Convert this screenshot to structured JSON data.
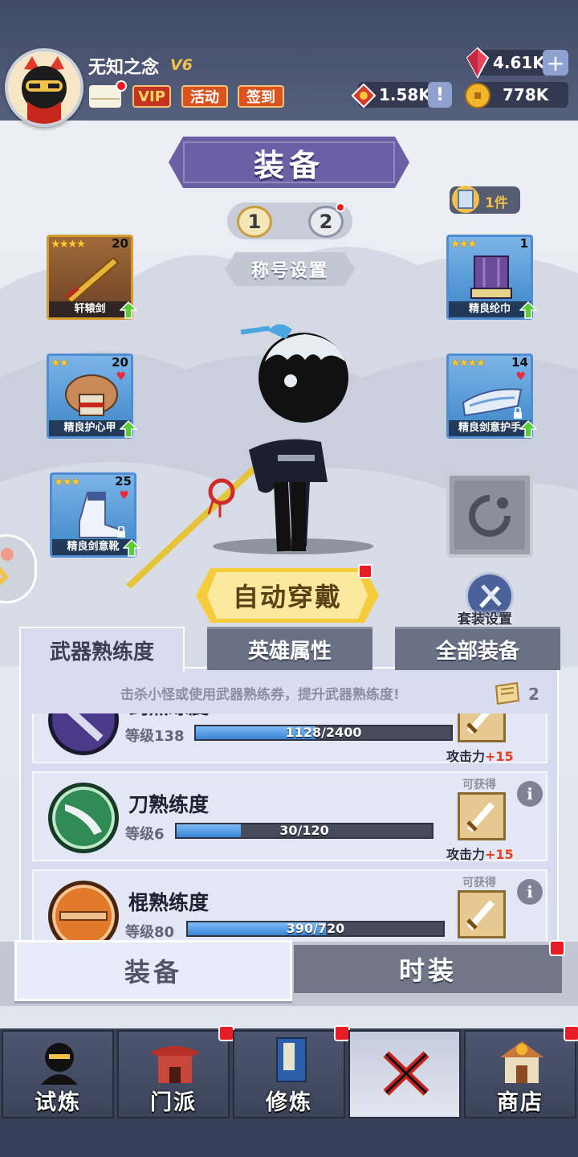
{
  "header": {
    "player_name": "无知之念",
    "vip_level": "V6",
    "buttons": {
      "vip": "VIP",
      "event": "活动",
      "signin": "签到"
    },
    "resources": {
      "gems": "4.61K",
      "tokens": "1.58K",
      "coins": "778K"
    }
  },
  "equipment": {
    "title": "装备",
    "pages": [
      "1",
      "2"
    ],
    "title_setting": "称号设置",
    "scroll_count": "1件",
    "slots": {
      "weapon": {
        "name": "轩辕剑",
        "level": "20",
        "stars": "★★★★"
      },
      "armor": {
        "name": "精良护心甲",
        "level": "20",
        "stars": "★★"
      },
      "boots": {
        "name": "精良剑意靴",
        "level": "25",
        "stars": "★★★"
      },
      "hat": {
        "name": "精良纶巾",
        "level": "1",
        "stars": "★★★"
      },
      "wrist": {
        "name": "精良剑意护手",
        "level": "14",
        "stars": "★★★★"
      }
    },
    "auto_equip": "自动穿戴",
    "set_setting": "套装设置"
  },
  "tabs": [
    "武器熟练度",
    "英雄属性",
    "全部装备"
  ],
  "mastery": {
    "hint": "击杀小怪或使用武器熟练券，提升武器熟练度!",
    "hint_count": "2",
    "items": [
      {
        "name": "剑熟练度",
        "level": "等级138",
        "progress": "1128/2400",
        "progress_fraction": 0.47,
        "obtain": "",
        "atk_label": "攻击力",
        "atk_value": "+15"
      },
      {
        "name": "刀熟练度",
        "level": "等级6",
        "progress": "30/120",
        "progress_fraction": 0.25,
        "obtain": "可获得",
        "atk_label": "攻击力",
        "atk_value": "+15"
      },
      {
        "name": "棍熟练度",
        "level": "等级80",
        "progress": "390/720",
        "progress_fraction": 0.54,
        "obtain": "可获得",
        "atk_label": "",
        "atk_value": ""
      }
    ]
  },
  "mode_tabs": {
    "equip": "装备",
    "fashion": "时装"
  },
  "nav": [
    "试炼",
    "门派",
    "修炼",
    "",
    "商店"
  ],
  "colors": {
    "accent_purple": "#6b5fa5",
    "gold": "#f5cc3b",
    "red_dot": "#e81c24",
    "bar_blue": "#3a84d6"
  }
}
